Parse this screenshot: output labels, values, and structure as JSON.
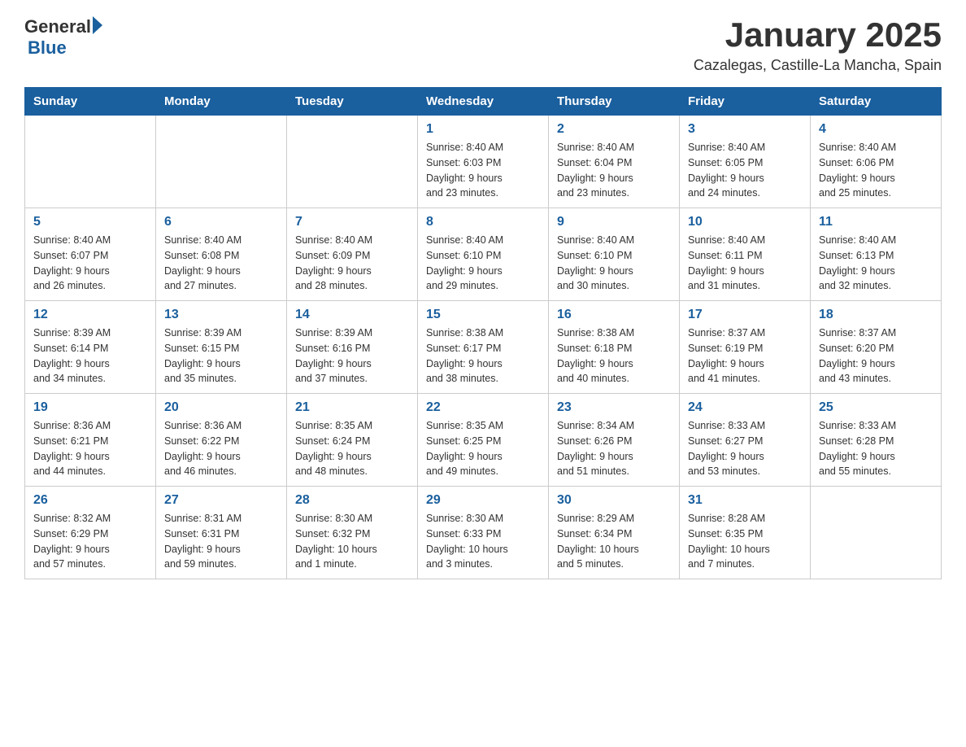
{
  "logo": {
    "general": "General",
    "blue": "Blue"
  },
  "title": "January 2025",
  "subtitle": "Cazalegas, Castille-La Mancha, Spain",
  "days_of_week": [
    "Sunday",
    "Monday",
    "Tuesday",
    "Wednesday",
    "Thursday",
    "Friday",
    "Saturday"
  ],
  "weeks": [
    [
      {
        "day": "",
        "info": ""
      },
      {
        "day": "",
        "info": ""
      },
      {
        "day": "",
        "info": ""
      },
      {
        "day": "1",
        "info": "Sunrise: 8:40 AM\nSunset: 6:03 PM\nDaylight: 9 hours\nand 23 minutes."
      },
      {
        "day": "2",
        "info": "Sunrise: 8:40 AM\nSunset: 6:04 PM\nDaylight: 9 hours\nand 23 minutes."
      },
      {
        "day": "3",
        "info": "Sunrise: 8:40 AM\nSunset: 6:05 PM\nDaylight: 9 hours\nand 24 minutes."
      },
      {
        "day": "4",
        "info": "Sunrise: 8:40 AM\nSunset: 6:06 PM\nDaylight: 9 hours\nand 25 minutes."
      }
    ],
    [
      {
        "day": "5",
        "info": "Sunrise: 8:40 AM\nSunset: 6:07 PM\nDaylight: 9 hours\nand 26 minutes."
      },
      {
        "day": "6",
        "info": "Sunrise: 8:40 AM\nSunset: 6:08 PM\nDaylight: 9 hours\nand 27 minutes."
      },
      {
        "day": "7",
        "info": "Sunrise: 8:40 AM\nSunset: 6:09 PM\nDaylight: 9 hours\nand 28 minutes."
      },
      {
        "day": "8",
        "info": "Sunrise: 8:40 AM\nSunset: 6:10 PM\nDaylight: 9 hours\nand 29 minutes."
      },
      {
        "day": "9",
        "info": "Sunrise: 8:40 AM\nSunset: 6:10 PM\nDaylight: 9 hours\nand 30 minutes."
      },
      {
        "day": "10",
        "info": "Sunrise: 8:40 AM\nSunset: 6:11 PM\nDaylight: 9 hours\nand 31 minutes."
      },
      {
        "day": "11",
        "info": "Sunrise: 8:40 AM\nSunset: 6:13 PM\nDaylight: 9 hours\nand 32 minutes."
      }
    ],
    [
      {
        "day": "12",
        "info": "Sunrise: 8:39 AM\nSunset: 6:14 PM\nDaylight: 9 hours\nand 34 minutes."
      },
      {
        "day": "13",
        "info": "Sunrise: 8:39 AM\nSunset: 6:15 PM\nDaylight: 9 hours\nand 35 minutes."
      },
      {
        "day": "14",
        "info": "Sunrise: 8:39 AM\nSunset: 6:16 PM\nDaylight: 9 hours\nand 37 minutes."
      },
      {
        "day": "15",
        "info": "Sunrise: 8:38 AM\nSunset: 6:17 PM\nDaylight: 9 hours\nand 38 minutes."
      },
      {
        "day": "16",
        "info": "Sunrise: 8:38 AM\nSunset: 6:18 PM\nDaylight: 9 hours\nand 40 minutes."
      },
      {
        "day": "17",
        "info": "Sunrise: 8:37 AM\nSunset: 6:19 PM\nDaylight: 9 hours\nand 41 minutes."
      },
      {
        "day": "18",
        "info": "Sunrise: 8:37 AM\nSunset: 6:20 PM\nDaylight: 9 hours\nand 43 minutes."
      }
    ],
    [
      {
        "day": "19",
        "info": "Sunrise: 8:36 AM\nSunset: 6:21 PM\nDaylight: 9 hours\nand 44 minutes."
      },
      {
        "day": "20",
        "info": "Sunrise: 8:36 AM\nSunset: 6:22 PM\nDaylight: 9 hours\nand 46 minutes."
      },
      {
        "day": "21",
        "info": "Sunrise: 8:35 AM\nSunset: 6:24 PM\nDaylight: 9 hours\nand 48 minutes."
      },
      {
        "day": "22",
        "info": "Sunrise: 8:35 AM\nSunset: 6:25 PM\nDaylight: 9 hours\nand 49 minutes."
      },
      {
        "day": "23",
        "info": "Sunrise: 8:34 AM\nSunset: 6:26 PM\nDaylight: 9 hours\nand 51 minutes."
      },
      {
        "day": "24",
        "info": "Sunrise: 8:33 AM\nSunset: 6:27 PM\nDaylight: 9 hours\nand 53 minutes."
      },
      {
        "day": "25",
        "info": "Sunrise: 8:33 AM\nSunset: 6:28 PM\nDaylight: 9 hours\nand 55 minutes."
      }
    ],
    [
      {
        "day": "26",
        "info": "Sunrise: 8:32 AM\nSunset: 6:29 PM\nDaylight: 9 hours\nand 57 minutes."
      },
      {
        "day": "27",
        "info": "Sunrise: 8:31 AM\nSunset: 6:31 PM\nDaylight: 9 hours\nand 59 minutes."
      },
      {
        "day": "28",
        "info": "Sunrise: 8:30 AM\nSunset: 6:32 PM\nDaylight: 10 hours\nand 1 minute."
      },
      {
        "day": "29",
        "info": "Sunrise: 8:30 AM\nSunset: 6:33 PM\nDaylight: 10 hours\nand 3 minutes."
      },
      {
        "day": "30",
        "info": "Sunrise: 8:29 AM\nSunset: 6:34 PM\nDaylight: 10 hours\nand 5 minutes."
      },
      {
        "day": "31",
        "info": "Sunrise: 8:28 AM\nSunset: 6:35 PM\nDaylight: 10 hours\nand 7 minutes."
      },
      {
        "day": "",
        "info": ""
      }
    ]
  ]
}
